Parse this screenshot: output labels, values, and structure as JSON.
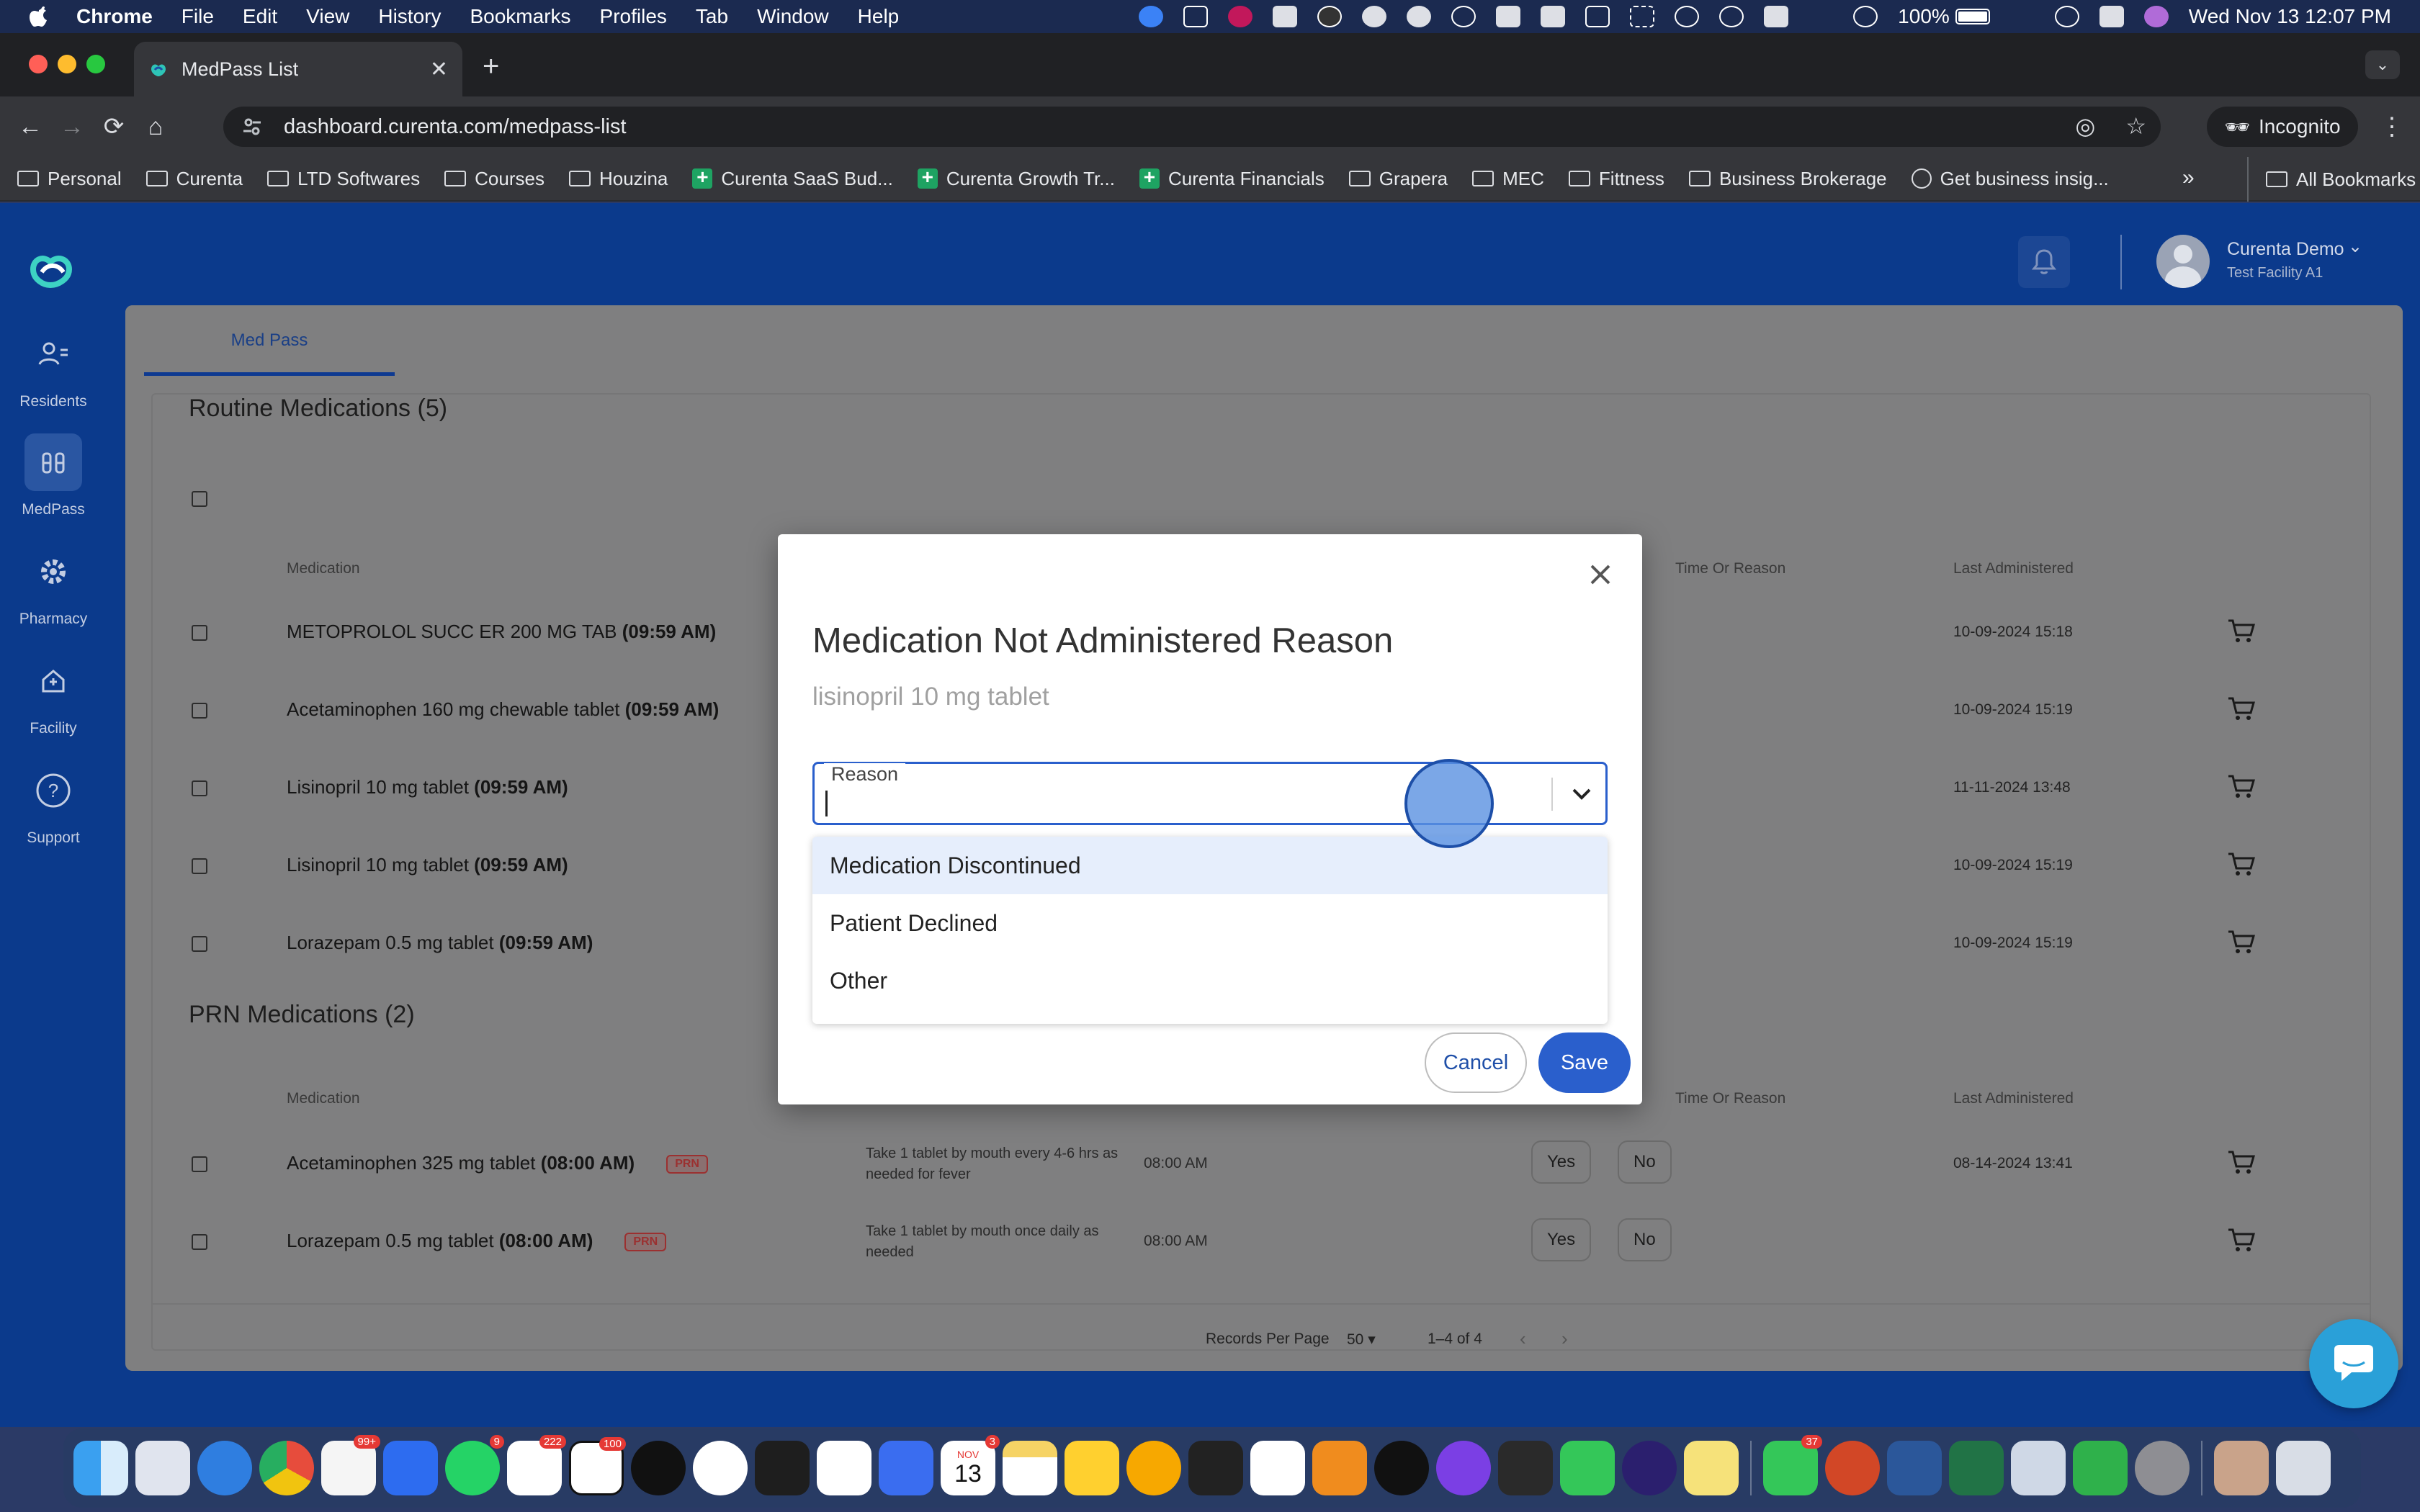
{
  "menubar": {
    "app": "Chrome",
    "items": [
      "File",
      "Edit",
      "View",
      "History",
      "Bookmarks",
      "Profiles",
      "Tab",
      "Window",
      "Help"
    ],
    "battery": "100%",
    "datetime": "Wed Nov 13  12:07 PM"
  },
  "browser": {
    "tab_title": "MedPass List",
    "url": "dashboard.curenta.com/medpass-list",
    "incognito_label": "Incognito",
    "bookmarks": [
      {
        "label": "Personal",
        "icon": "folder-icon"
      },
      {
        "label": "Curenta",
        "icon": "folder-icon"
      },
      {
        "label": "LTD Softwares",
        "icon": "folder-icon"
      },
      {
        "label": "Courses",
        "icon": "folder-icon"
      },
      {
        "label": "Houzina",
        "icon": "folder-icon"
      },
      {
        "label": "Curenta SaaS Bud...",
        "icon": "sheets-icon"
      },
      {
        "label": "Curenta Growth Tr...",
        "icon": "sheets-icon"
      },
      {
        "label": "Curenta Financials",
        "icon": "sheets-icon"
      },
      {
        "label": "Grapera",
        "icon": "folder-icon"
      },
      {
        "label": "MEC",
        "icon": "folder-icon"
      },
      {
        "label": "Fittness",
        "icon": "folder-icon"
      },
      {
        "label": "Business Brokerage",
        "icon": "folder-icon"
      },
      {
        "label": "Get business insig...",
        "icon": "globe-icon"
      }
    ],
    "all_bookmarks": "All Bookmarks"
  },
  "app": {
    "user": {
      "name": "Curenta Demo",
      "facility": "Test Facility A1"
    },
    "sidebar": [
      {
        "label": "Residents",
        "icon": "residents-icon"
      },
      {
        "label": "MedPass",
        "icon": "medpass-icon"
      },
      {
        "label": "Pharmacy",
        "icon": "gear-icon"
      },
      {
        "label": "Facility",
        "icon": "facility-icon"
      },
      {
        "label": "Support",
        "icon": "help-icon"
      }
    ],
    "tab": "Med Pass",
    "routine": {
      "title": "Routine Medications (5)",
      "headers": {
        "medication": "Medication",
        "time_reason": "Time Or Reason",
        "last": "Last Administered"
      },
      "rows": [
        {
          "name": "METOPROLOL SUCC ER 200 MG TAB",
          "time": "(09:59 AM)",
          "last": "10-09-2024 15:18"
        },
        {
          "name": "Acetaminophen 160 mg chewable tablet",
          "time": "(09:59 AM)",
          "last": "10-09-2024 15:19"
        },
        {
          "name": "Lisinopril 10 mg tablet",
          "time": "(09:59 AM)",
          "last": "11-11-2024 13:48"
        },
        {
          "name": "Lisinopril 10 mg tablet",
          "time": "(09:59 AM)",
          "last": "10-09-2024 15:19"
        },
        {
          "name": "Lorazepam 0.5 mg tablet",
          "time": "(09:59 AM)",
          "last": "10-09-2024 15:19"
        }
      ]
    },
    "prn": {
      "title": "PRN Medications (2)",
      "headers": {
        "medication": "Medication",
        "time_reason": "Time Or Reason",
        "last": "Last Administered"
      },
      "badge": "PRN",
      "yes": "Yes",
      "no": "No",
      "rows": [
        {
          "name": "Acetaminophen 325 mg tablet",
          "time": "(08:00 AM)",
          "instructions": "Take 1 tablet by mouth every 4-6 hrs as needed for fever",
          "scheduled": "08:00 AM",
          "last": "08-14-2024 13:41"
        },
        {
          "name": "Lorazepam 0.5 mg tablet",
          "time": "(08:00 AM)",
          "instructions": "Take 1 tablet by mouth once daily as needed",
          "scheduled": "08:00 AM",
          "last": ""
        }
      ]
    },
    "footer": {
      "records_label": "Records Per Page",
      "per_page": "50",
      "range": "1–4 of 4"
    }
  },
  "modal": {
    "title": "Medication Not Administered Reason",
    "subtitle": "lisinopril 10 mg tablet",
    "reason_label": "Reason",
    "reason_value": "",
    "options": [
      "Medication Discontinued",
      "Patient Declined",
      "Other"
    ],
    "cancel": "Cancel",
    "save": "Save"
  },
  "dock": {
    "badges": {
      "mail": "99+",
      "whatsapp": "9",
      "slack": "222",
      "notion": "100",
      "calendar_day": "13",
      "calendar_month": "NOV",
      "calendar_badge": "3",
      "messages": "37"
    }
  }
}
